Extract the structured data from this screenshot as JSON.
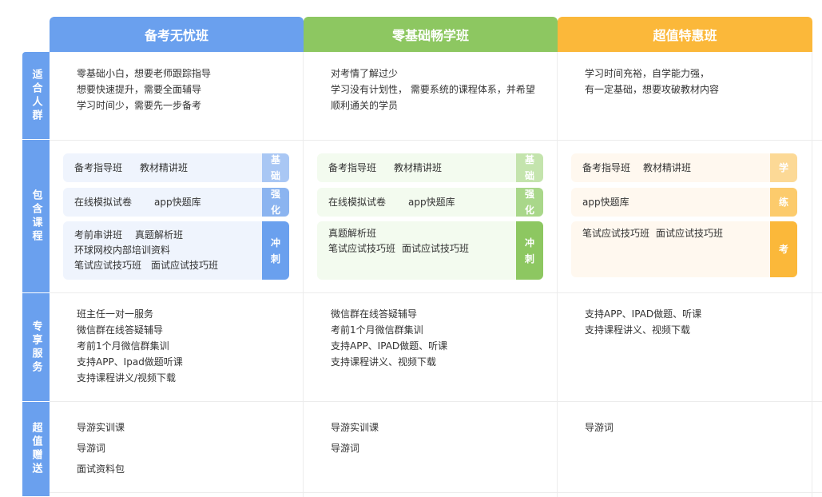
{
  "headers": {
    "plan1": "备考无忧班",
    "plan2": "零基础畅学班",
    "plan3": "超值特惠班"
  },
  "rows": {
    "audience": "适合人群",
    "courses": "包含课程",
    "services": "专享服务",
    "gifts": "超值赠送"
  },
  "audience": {
    "plan1": [
      "零基础小白，想要老师跟踪指导",
      "想要快速提升，需要全面辅导",
      "学习时间少，需要先一步备考"
    ],
    "plan2": [
      "对考情了解过少",
      "学习没有计划性， 需要系统的课程体系，并希望",
      "顺利通关的学员"
    ],
    "plan3": [
      "学习时间充裕，自学能力强，",
      "有一定基础，想要攻破教材内容"
    ]
  },
  "course_tags": {
    "basic": "基础",
    "strengthen": "强化",
    "sprint": "冲刺",
    "learn": "学",
    "practice": "练",
    "exam": "考"
  },
  "courses": {
    "plan1": {
      "basic": [
        "备考指导班",
        "教材精讲班"
      ],
      "strengthen": [
        "在线模拟试卷",
        "app快题库"
      ],
      "sprint": [
        "考前串讲班",
        "真题解析班",
        "环球网校内部培训资料",
        "笔试应试技巧班",
        "面试应试技巧班"
      ]
    },
    "plan2": {
      "basic": [
        "备考指导班",
        "教材精讲班"
      ],
      "strengthen": [
        "在线模拟试卷",
        "app快题库"
      ],
      "sprint": [
        "真题解析班",
        "笔试应试技巧班",
        "面试应试技巧班"
      ]
    },
    "plan3": {
      "learn": [
        "备考指导班",
        "教材精讲班"
      ],
      "practice": [
        "app快题库"
      ],
      "exam": [
        "笔试应试技巧班",
        "面试应试技巧班"
      ]
    }
  },
  "services": {
    "plan1": [
      "班主任一对一服务",
      "微信群在线答疑辅导",
      "考前1个月微信群集训",
      "支持APP、Ipad做题听课",
      "支持课程讲义/视频下载"
    ],
    "plan2": [
      "微信群在线答疑辅导",
      "考前1个月微信群集训",
      "支持APP、IPAD做题、听课",
      "支持课程讲义、视频下载"
    ],
    "plan3": [
      "支持APP、IPAD做题、听课",
      "支持课程讲义、视频下载"
    ]
  },
  "gifts": {
    "plan1": [
      "导游实训课",
      "导游词",
      "面试资料包"
    ],
    "plan2": [
      "导游实训课",
      "导游词"
    ],
    "plan3": [
      "导游词"
    ]
  },
  "colors": {
    "blue": "#6aa0ee",
    "green": "#8dc761",
    "orange": "#fbb83a"
  }
}
